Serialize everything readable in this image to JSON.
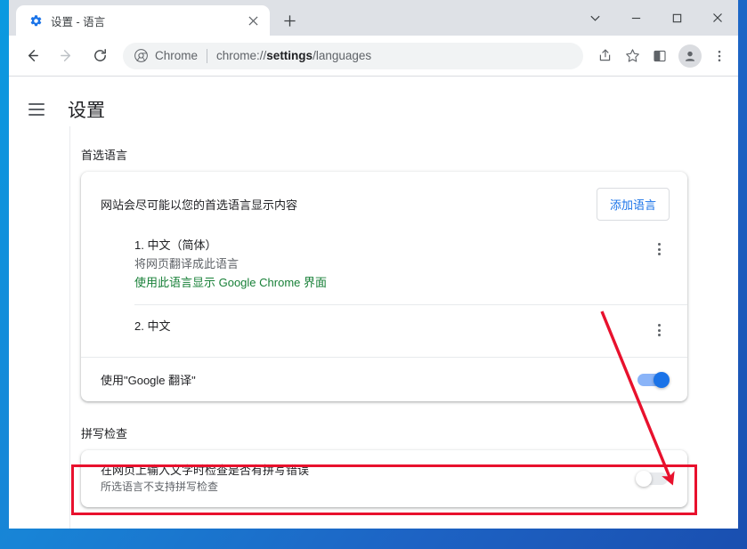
{
  "window": {
    "tab": {
      "title": "设置 - 语言",
      "favicon": "settings-gear-icon",
      "close_label": "✕"
    },
    "new_tab_label": "+",
    "controls": {
      "tab_search_label": "⌄",
      "minimize_label": "—",
      "maximize_label": "□",
      "close_label": "✕"
    }
  },
  "toolbar": {
    "back_label": "←",
    "forward_label": "→",
    "reload_label": "⟳",
    "omnibox": {
      "scheme_label": "Chrome",
      "url_prefix": "chrome://",
      "url_bold": "settings",
      "url_suffix": "/languages"
    },
    "share_icon": "share-icon",
    "bookmark_icon": "star-icon",
    "sidepanel_icon": "side-panel-icon",
    "profile_icon": "avatar-icon",
    "menu_icon": "three-dot-menu-icon"
  },
  "settings": {
    "menu_icon": "hamburger-icon",
    "title": "设置",
    "preferred_languages": {
      "section_label": "首选语言",
      "intro": "网站会尽可能以您的首选语言显示内容",
      "add_button": "添加语言",
      "languages": [
        {
          "name": "1. 中文（简体）",
          "sub": "将网页翻译成此语言",
          "link": "使用此语言显示 Google Chrome 界面",
          "menu_icon": "kebab-menu-icon"
        },
        {
          "name": "2. 中文",
          "sub": "",
          "link": "",
          "menu_icon": "kebab-menu-icon"
        }
      ],
      "translate_row": {
        "label": "使用\"Google 翻译\"",
        "toggle_state": "on"
      }
    },
    "spellcheck": {
      "section_label": "拼写检查",
      "title": "在网页上输入文字时检查是否有拼写错误",
      "sub": "所选语言不支持拼写检查",
      "toggle_state": "off"
    }
  },
  "annotations": {
    "highlight_color": "#e8112d",
    "arrow_color": "#e8112d"
  }
}
